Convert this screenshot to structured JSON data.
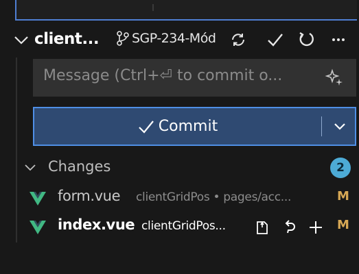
{
  "header": {
    "repo_name": "client...",
    "branch": "SGP-234-Mód"
  },
  "commit_message": {
    "placeholder": "Message (Ctrl+⏎ to commit o..."
  },
  "commit_button": {
    "label": "Commit"
  },
  "changes": {
    "label": "Changes",
    "count": "2",
    "files": [
      {
        "name": "form.vue",
        "path": "clientGridPos • pages/acc...",
        "status": "M"
      },
      {
        "name": "index.vue",
        "path": "clientGridPos...",
        "status": "M"
      }
    ]
  },
  "colors": {
    "accent": "#4f8fe6",
    "commit_bg": "#2f4a72",
    "vue_green": "#41b883",
    "modified": "#d7a855",
    "badge": "#4dabd6"
  }
}
